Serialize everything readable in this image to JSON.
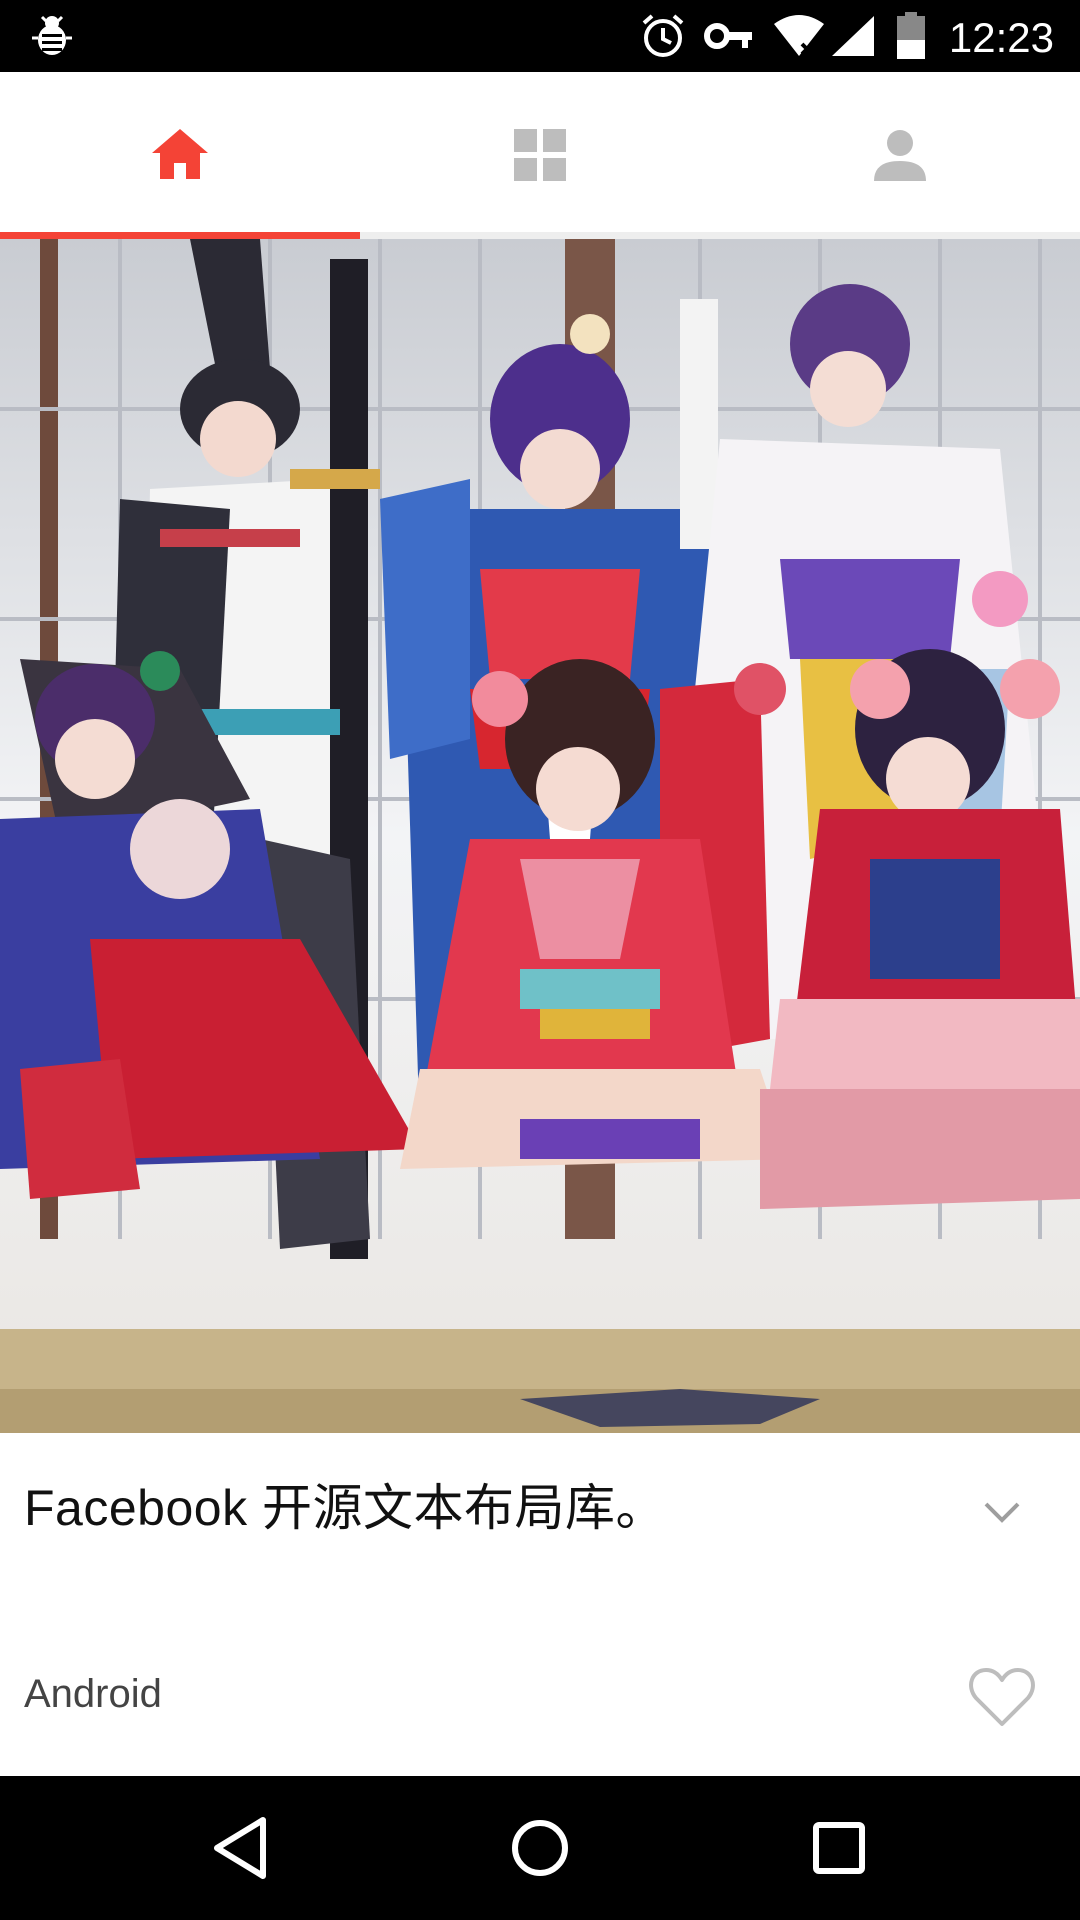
{
  "status_bar": {
    "time": "12:23",
    "icons": [
      "debug-bug-icon",
      "alarm-icon",
      "vpn-key-icon",
      "wifi-off-icon",
      "signal-icon",
      "battery-icon"
    ]
  },
  "tabs": [
    {
      "name": "home",
      "icon": "home-icon",
      "active": true
    },
    {
      "name": "dashboard",
      "icon": "grid-icon",
      "active": false
    },
    {
      "name": "profile",
      "icon": "person-icon",
      "active": false
    }
  ],
  "colors": {
    "accent": "#f44336",
    "inactive_icon": "#bdbdbd",
    "text": "#111111"
  },
  "card": {
    "title": "Facebook 开源文本布局库。",
    "tag": "Android",
    "liked": false
  },
  "nav_bar": {
    "icons": [
      "back-icon",
      "home-circle-icon",
      "recents-icon"
    ]
  }
}
